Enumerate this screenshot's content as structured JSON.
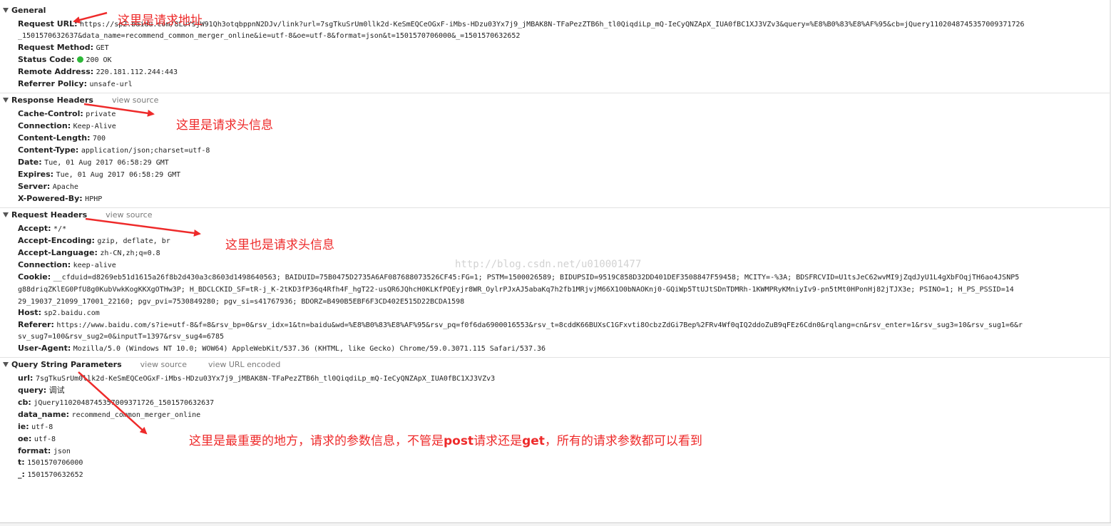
{
  "general": {
    "title": "General",
    "rows": [
      {
        "key": "Request URL:",
        "value": "https://sp2.baidu.com/8LUYsjW91Qh3otqbppnN2DJv/link?url=7sgTkuSrUm0llk2d-KeSmEQCeOGxF-iMbs-HDzu03Yx7j9_jMBAK8N-TFaPezZTB6h_tl0QiqdiLp_mQ-IeCyQNZApX_IUA0fBC1XJ3VZv3&query=%E8%B0%83%E8%AF%95&cb=jQuery1102048745357009371726",
        "value2": "_1501570632637&data_name=recommend_common_merger_online&ie=utf-8&oe=utf-8&format=json&t=1501570706000&_=1501570632652"
      },
      {
        "key": "Request Method:",
        "value": "GET"
      },
      {
        "key": "Status Code:",
        "value": "200 OK"
      },
      {
        "key": "Remote Address:",
        "value": "220.181.112.244:443"
      },
      {
        "key": "Referrer Policy:",
        "value": "unsafe-url"
      }
    ]
  },
  "response_headers": {
    "title": "Response Headers",
    "view_source": "view source",
    "rows": [
      {
        "key": "Cache-Control:",
        "value": "private"
      },
      {
        "key": "Connection:",
        "value": "Keep-Alive"
      },
      {
        "key": "Content-Length:",
        "value": "700"
      },
      {
        "key": "Content-Type:",
        "value": "application/json;charset=utf-8"
      },
      {
        "key": "Date:",
        "value": "Tue, 01 Aug 2017 06:58:29 GMT"
      },
      {
        "key": "Expires:",
        "value": "Tue, 01 Aug 2017 06:58:29 GMT"
      },
      {
        "key": "Server:",
        "value": "Apache"
      },
      {
        "key": "X-Powered-By:",
        "value": "HPHP"
      }
    ]
  },
  "request_headers": {
    "title": "Request Headers",
    "view_source": "view source",
    "rows": [
      {
        "key": "Accept:",
        "value": "*/*"
      },
      {
        "key": "Accept-Encoding:",
        "value": "gzip, deflate, br"
      },
      {
        "key": "Accept-Language:",
        "value": "zh-CN,zh;q=0.8"
      },
      {
        "key": "Connection:",
        "value": "keep-alive"
      },
      {
        "key": "Cookie:",
        "value": "__cfduid=d8269eb51d1615a26f8b2d430a3c8603d1498640563; BAIDUID=75B0475D2735A6AF087688073526CF45:FG=1; PSTM=1500026589; BIDUPSID=9519C858D32DD401DEF3508847F59458; MCITY=-%3A; BDSFRCVID=U1tsJeC62wvMI9jZqdJyU1L4gXbFOqjTH6ao4JSNP5",
        "value2": "g88driqZKlEG0PfU8g0KubVwkKogKKXgOTHw3P; H_BDCLCKID_SF=tR-j_K-2tKD3fP36q4Rfh4F_hgT22-usQR6JQhcH0KLKfPQEyjr8WR_OylrPJxAJ5abaKq7h2fb1MRjvjM66X1O0bNAOKnj0-GQiWp5TtUJtSDnTDMRh-1KWMPRyKMniyIv9-pn5tMt0HPonHj82jTJX3e; PSINO=1; H_PS_PSSID=14",
        "value3": "29_19037_21099_17001_22160; pgv_pvi=7530849280; pgv_si=s41767936; BDORZ=B490B5EBF6F3CD402E515D22BCDA1598"
      },
      {
        "key": "Host:",
        "value": "sp2.baidu.com"
      },
      {
        "key": "Referer:",
        "value": "https://www.baidu.com/s?ie=utf-8&f=8&rsv_bp=0&rsv_idx=1&tn=baidu&wd=%E8%B0%83%E8%AF%95&rsv_pq=f0f6da6900016553&rsv_t=8cddK66BUXsC1GFxvti8OcbzZdGi7Bep%2FRv4Wf0qIQ2ddoZuB9qFEz6Cdn0&rqlang=cn&rsv_enter=1&rsv_sug3=10&rsv_sug1=6&r",
        "value2": "sv_sug7=100&rsv_sug2=0&inputT=1397&rsv_sug4=6785"
      },
      {
        "key": "User-Agent:",
        "value": "Mozilla/5.0 (Windows NT 10.0; WOW64) AppleWebKit/537.36 (KHTML, like Gecko) Chrome/59.0.3071.115 Safari/537.36"
      }
    ]
  },
  "query_params": {
    "title": "Query String Parameters",
    "view_source": "view source",
    "view_url_encoded": "view URL encoded",
    "rows": [
      {
        "key": "url:",
        "value": "7sgTkuSrUm0llk2d-KeSmEQCeOGxF-iMbs-HDzu03Yx7j9_jMBAK8N-TFaPezZTB6h_tl0QiqdiLp_mQ-IeCyQNZApX_IUA0fBC1XJ3VZv3"
      },
      {
        "key": "query:",
        "value": "调试"
      },
      {
        "key": "cb:",
        "value": "jQuery1102048745357009371726_1501570632637"
      },
      {
        "key": "data_name:",
        "value": "recommend_common_merger_online"
      },
      {
        "key": "ie:",
        "value": "utf-8"
      },
      {
        "key": "oe:",
        "value": "utf-8"
      },
      {
        "key": "format:",
        "value": "json"
      },
      {
        "key": "t:",
        "value": "1501570706000"
      },
      {
        "key": "_:",
        "value": "1501570632652"
      }
    ]
  },
  "annotations": {
    "request_url": "这里是请求地址",
    "response_headers": "这里是请求头信息",
    "request_headers": "这里也是请求头信息",
    "params_1": "这里是最重要的地方，请求的参数信息，不管是",
    "params_post": "post",
    "params_2": "请求还是",
    "params_get": "get",
    "params_3": "，所有的请求参数都可以看到"
  },
  "watermark": "http://blog.csdn.net/u010001477",
  "colors": {
    "annotation": "#ee2a2a",
    "status_ok": "#2db838",
    "link_gray": "#7a7a7a"
  }
}
